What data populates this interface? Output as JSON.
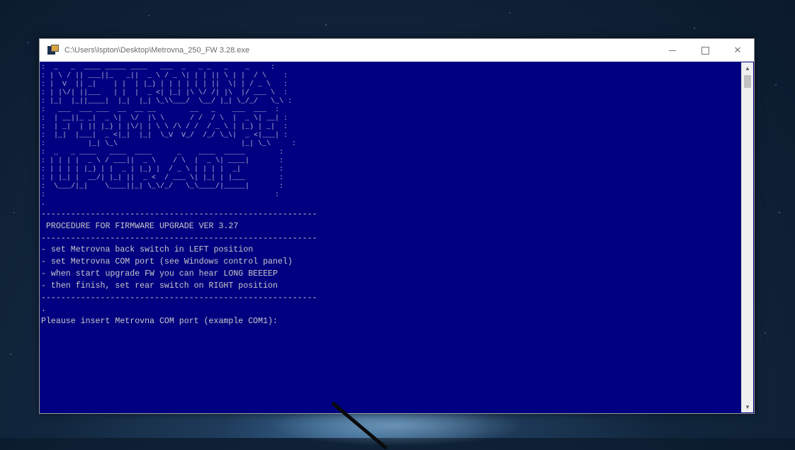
{
  "window": {
    "title": "C:\\Users\\Ispton\\Desktop\\Metrovna_250_FW 3.28.exe",
    "icon": "console-app-icon",
    "controls": {
      "minimize": "minimize-icon",
      "maximize": "maximize-icon",
      "close": "✕"
    }
  },
  "console": {
    "background": "#000080",
    "text_color": "#c0c0c0",
    "banner_text": ":  _   _  ____ _____ ____   ___  _   _ _   _    _     :\n: | \\ / || ___||_   _||  _ \\ / _ \\| | | || \\ | |  / \\    :\n: |  V  || _|    | |  | |_) | | | | | | ||  \\| | / _ \\   :\n: | |\\/| ||___   | |  |  _ <| |_| |\\ \\/ /| |\\  |/ ___ \\  :\n: |_|  |_||____|  |_|  |_| \\_\\\\___/  \\__/ |_| \\_/_/   \\_\\ :\n:   ___  ___ ___  __  __ __        __   _    ___  ___  :\n:  | __||_ _|  _ \\|  \\/  |\\ \\      / /  / \\  |  _ \\| __| :\n:  | _|  | || |_) | |\\/| | \\ \\ /\\ / /  / _ \\ | |_) | _|  :\n:  |_|  |___|  _ <|_|  |_|  \\_V  V_/  /_/ \\_\\|  _ <|___| :\n:          |_| \\_\\                             |_| \\_\\     :\n:  _   _ ____   ____  ____      _    ____  _____        :\n: | | | |  _ \\ / ___||  _ \\    / \\  |  _ \\| ____|       :\n: | | | | |_) | |  _ | |_) |  / _ \\ | | | |  _|         :\n: | |_| |  __/| |_| ||  _ <  / ___ \\| |_| | |___        :\n:  \\___/|_|    \\____||_| \\_\\/_/   \\_\\____/|_____|       :\n:                                                      :\n.",
    "lines": [
      "--------------------------------------------------------",
      " PROCEDURE FOR FIRMWARE UPGRADE VER 3.27",
      "--------------------------------------------------------",
      "- set Metrovna back switch in LEFT position",
      "- set Metrovna COM port (see Windows control panel)",
      "- when start upgrade FW you can hear LONG BEEEEP",
      "- then finish, set rear switch on RIGHT position",
      "--------------------------------------------------------",
      ".",
      "Pleause insert Metrovna COM port (example COM1):"
    ]
  },
  "scrollbar": {
    "up": "▲",
    "down": "▼"
  }
}
